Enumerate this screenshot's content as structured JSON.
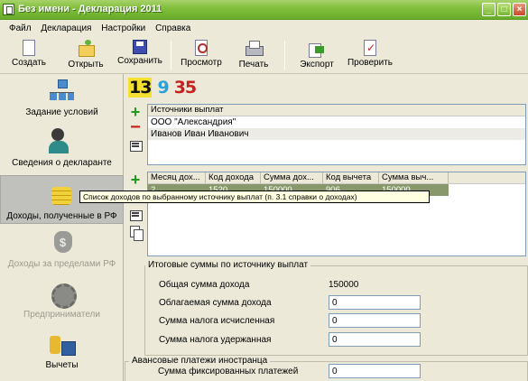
{
  "window": {
    "title": "Без имени - Декларация 2011"
  },
  "menu": [
    "Файл",
    "Декларация",
    "Настройки",
    "Справка"
  ],
  "toolbar": {
    "create": "Создать",
    "open": "Открыть",
    "save": "Сохранить",
    "preview": "Просмотр",
    "print": "Печать",
    "export": "Экспорт",
    "check": "Проверить"
  },
  "sidebar": {
    "items": [
      {
        "label": "Задание условий",
        "icon": "tree-icon"
      },
      {
        "label": "Сведения о декларанте",
        "icon": "person-icon"
      },
      {
        "label": "Доходы, полученные в РФ",
        "icon": "coins-icon",
        "active": true
      },
      {
        "label": "Доходы за пределами РФ",
        "icon": "money-bag-icon",
        "disabled": true
      },
      {
        "label": "Предприниматели",
        "icon": "gears-icon",
        "disabled": true
      },
      {
        "label": "Вычеты",
        "icon": "deductions-icon"
      }
    ]
  },
  "codes": {
    "first": "13",
    "second": "9",
    "third": "35"
  },
  "sources": {
    "header": "Источники выплат",
    "rows": [
      "ООО \"Александрия\"",
      "Иванов Иван Иванович"
    ]
  },
  "income_table": {
    "headers": [
      "Месяц дох...",
      "Код дохода",
      "Сумма дох...",
      "Код вычета",
      "Сумма выч..."
    ],
    "rows": [
      [
        "2",
        "1520",
        "150000",
        "906",
        "150000"
      ]
    ]
  },
  "tooltip": "Список доходов по выбранному источнику выплат (п. 3.1 справки о доходах)",
  "totals": {
    "title": "Итоговые суммы по источнику выплат",
    "total_income_label": "Общая сумма дохода",
    "total_income_value": "150000",
    "taxable_label": "Облагаемая сумма дохода",
    "taxable_value": "0",
    "tax_calc_label": "Сумма налога исчисленная",
    "tax_calc_value": "0",
    "tax_withheld_label": "Сумма налога удержанная",
    "tax_withheld_value": "0"
  },
  "advance": {
    "title": "Авансовые платежи иностранца",
    "fixed_label": "Сумма фиксированных платежей",
    "fixed_value": "0"
  }
}
